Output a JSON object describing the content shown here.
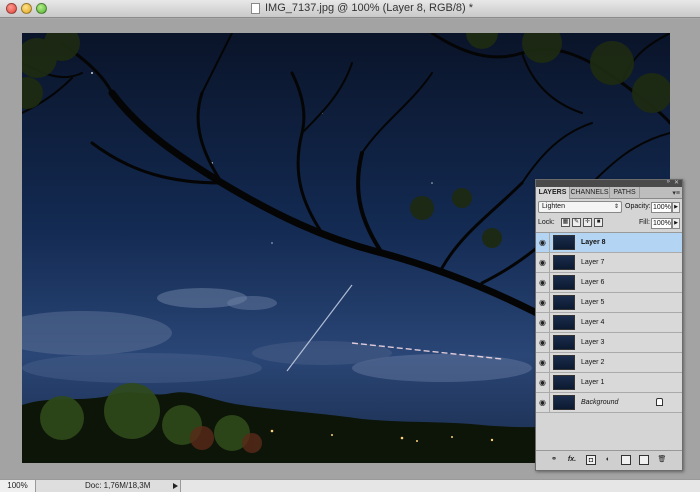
{
  "window": {
    "title": "IMG_7137.jpg @ 100% (Layer 8, RGB/8) *"
  },
  "statusbar": {
    "zoom": "100%",
    "doc_info": "Doc: 1,76M/18,3M"
  },
  "layers_panel": {
    "tabs": [
      {
        "label": "LAYERS",
        "active": true
      },
      {
        "label": "CHANNELS",
        "active": false
      },
      {
        "label": "PATHS",
        "active": false
      }
    ],
    "blend_mode": "Lighten",
    "opacity_label": "Opacity:",
    "opacity_value": "100%",
    "lock_label": "Lock:",
    "fill_label": "Fill:",
    "fill_value": "100%",
    "layers": [
      {
        "name": "Layer 8",
        "selected": true,
        "locked": false
      },
      {
        "name": "Layer 7",
        "selected": false,
        "locked": false
      },
      {
        "name": "Layer 6",
        "selected": false,
        "locked": false
      },
      {
        "name": "Layer 5",
        "selected": false,
        "locked": false
      },
      {
        "name": "Layer 4",
        "selected": false,
        "locked": false
      },
      {
        "name": "Layer 3",
        "selected": false,
        "locked": false
      },
      {
        "name": "Layer 2",
        "selected": false,
        "locked": false
      },
      {
        "name": "Layer 1",
        "selected": false,
        "locked": false
      },
      {
        "name": "Background",
        "selected": false,
        "locked": true
      }
    ],
    "footer_icons": [
      "link-icon",
      "fx-icon",
      "mask-icon",
      "adjustment-icon",
      "folder-icon",
      "new-layer-icon",
      "trash-icon"
    ],
    "footer_labels": {
      "fx": "fx."
    }
  },
  "colors": {
    "selected_layer": "#b4d4f3",
    "sky_top": "#0b1630",
    "sky_bottom": "#27406b"
  }
}
